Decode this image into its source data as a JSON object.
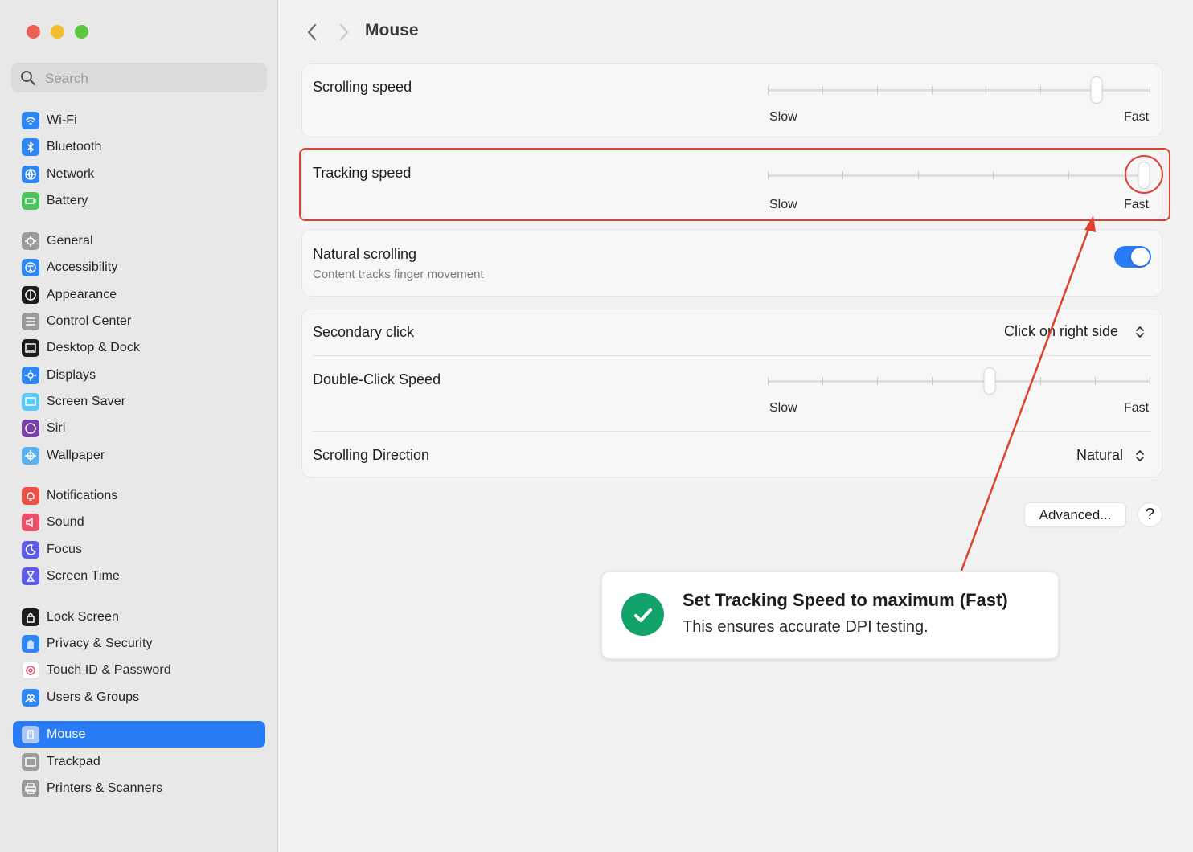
{
  "window": {
    "title": "Mouse",
    "controls": [
      "close",
      "minimize",
      "zoom"
    ]
  },
  "search": {
    "placeholder": "Search",
    "value": ""
  },
  "sidebar": {
    "items": [
      {
        "label": "Wi-Fi",
        "icon": "wifi-icon",
        "color": "#2d86f4"
      },
      {
        "label": "Bluetooth",
        "icon": "bluetooth-icon",
        "color": "#2d86f4"
      },
      {
        "label": "Network",
        "icon": "globe-icon",
        "color": "#2d86f4"
      },
      {
        "label": "Battery",
        "icon": "battery-icon",
        "color": "#4cc55f"
      },
      {
        "label": "General",
        "icon": "gear-icon",
        "color": "#9b9b9b"
      },
      {
        "label": "Accessibility",
        "icon": "accessibility-icon",
        "color": "#2d86f4"
      },
      {
        "label": "Appearance",
        "icon": "appearance-icon",
        "color": "#1d1d1f"
      },
      {
        "label": "Control Center",
        "icon": "control-center-icon",
        "color": "#9b9b9b"
      },
      {
        "label": "Desktop & Dock",
        "icon": "dock-icon",
        "color": "#1d1d1f"
      },
      {
        "label": "Displays",
        "icon": "sun-icon",
        "color": "#2d86f4"
      },
      {
        "label": "Screen Saver",
        "icon": "screen-saver-icon",
        "color": "#5ac8fa"
      },
      {
        "label": "Siri",
        "icon": "siri-icon",
        "color": "#7b3fa8"
      },
      {
        "label": "Wallpaper",
        "icon": "flower-icon",
        "color": "#5ab0f0"
      },
      {
        "label": "Notifications",
        "icon": "bell-icon",
        "color": "#ec4f44"
      },
      {
        "label": "Sound",
        "icon": "speaker-icon",
        "color": "#ec4f6c"
      },
      {
        "label": "Focus",
        "icon": "moon-icon",
        "color": "#5e5ce6"
      },
      {
        "label": "Screen Time",
        "icon": "hourglass-icon",
        "color": "#5e5ce6"
      },
      {
        "label": "Lock Screen",
        "icon": "lock-icon",
        "color": "#1d1d1f"
      },
      {
        "label": "Privacy & Security",
        "icon": "hand-icon",
        "color": "#2d86f4"
      },
      {
        "label": "Touch ID & Password",
        "icon": "fingerprint-icon",
        "color": "#ffffff"
      },
      {
        "label": "Users & Groups",
        "icon": "users-icon",
        "color": "#2d86f4"
      },
      {
        "label": "Mouse",
        "icon": "mouse-icon",
        "color": "#a9c8f8",
        "active": true
      },
      {
        "label": "Trackpad",
        "icon": "trackpad-icon",
        "color": "#9b9b9b"
      },
      {
        "label": "Printers & Scanners",
        "icon": "printer-icon",
        "color": "#9b9b9b"
      }
    ]
  },
  "main": {
    "title": "Mouse",
    "scrolling_speed": {
      "label": "Scrolling speed",
      "slow": "Slow",
      "fast": "Fast",
      "value": 0.86,
      "ticks": 8
    },
    "tracking_speed": {
      "label": "Tracking speed",
      "slow": "Slow",
      "fast": "Fast",
      "value": 1.0,
      "ticks": 6
    },
    "natural_scrolling": {
      "label": "Natural scrolling",
      "sub": "Content tracks finger movement",
      "on": true
    },
    "secondary_click": {
      "label": "Secondary click",
      "value": "Click on right side"
    },
    "double_click": {
      "label": "Double-Click Speed",
      "slow": "Slow",
      "fast": "Fast",
      "value": 0.58,
      "ticks": 8
    },
    "scrolling_direction": {
      "label": "Scrolling Direction",
      "value": "Natural"
    },
    "advanced_label": "Advanced...",
    "help_label": "?"
  },
  "callout": {
    "title": "Set Tracking Speed to maximum (Fast)",
    "subtitle": "This ensures accurate DPI testing."
  },
  "colors": {
    "accent": "#2a7cf6",
    "annotation": "#e0412f",
    "success": "#12a36a"
  }
}
